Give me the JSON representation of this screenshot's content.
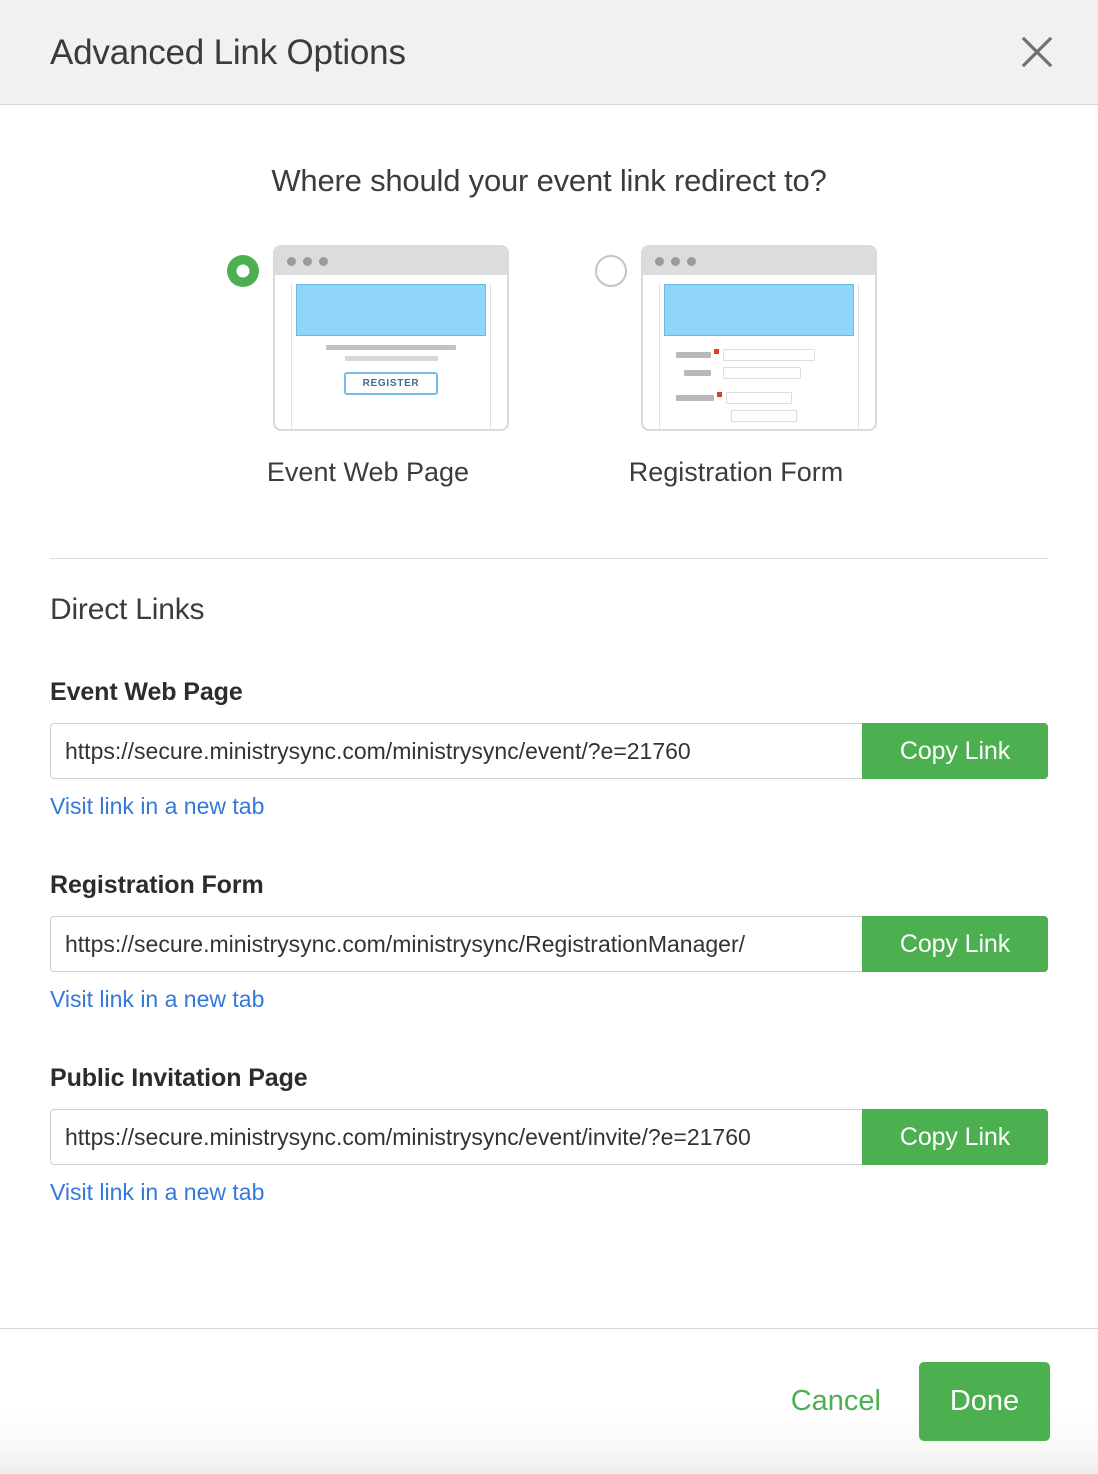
{
  "header": {
    "title": "Advanced Link Options",
    "close_icon": "close-icon"
  },
  "main": {
    "question": "Where should your event link redirect to?",
    "choices": [
      {
        "label": "Event Web Page",
        "selected": true,
        "thumbnail": "event-web-page-preview",
        "preview_button_label": "REGISTER"
      },
      {
        "label": "Registration Form",
        "selected": false,
        "thumbnail": "registration-form-preview"
      }
    ],
    "section_title": "Direct Links",
    "links": [
      {
        "label": "Event Web Page",
        "url": "https://secure.ministrysync.com/ministrysync/event/?e=21760",
        "copy_label": "Copy Link",
        "visit_label": "Visit link in a new tab"
      },
      {
        "label": "Registration Form",
        "url": "https://secure.ministrysync.com/ministrysync/RegistrationManager/",
        "copy_label": "Copy Link",
        "visit_label": "Visit link in a new tab"
      },
      {
        "label": "Public Invitation Page",
        "url": "https://secure.ministrysync.com/ministrysync/event/invite/?e=21760",
        "copy_label": "Copy Link",
        "visit_label": "Visit link in a new tab"
      }
    ]
  },
  "footer": {
    "cancel_label": "Cancel",
    "done_label": "Done"
  },
  "colors": {
    "accent_green": "#4caf50",
    "link_blue": "#3478d8",
    "header_bg": "#f1f1f1",
    "hero_blue": "#8fd6fa",
    "required_red": "#e03a2f"
  }
}
